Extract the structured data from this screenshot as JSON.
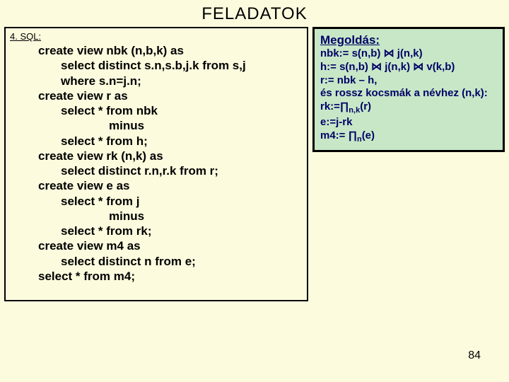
{
  "title": "FELADATOK",
  "sql_label": "4. SQL:",
  "sql": {
    "l1": "create view nbk (n,b,k) as",
    "l2": "select distinct s.n,s.b,j.k from s,j",
    "l3": "where s.n=j.n;",
    "l4": "create view r as",
    "l5": "select * from nbk",
    "l6": "minus",
    "l7": "select * from h;",
    "l8": "create view rk (n,k) as",
    "l9": "select distinct r.n,r.k from r;",
    "l10": "create view e as",
    "l11": "select * from j",
    "l12": "minus",
    "l13": "select * from rk;",
    "l14": "create view m4 as",
    "l15": "select distinct n from e;",
    "l16": "select * from m4;"
  },
  "solution": {
    "title": "Megoldás:",
    "nbk_lhs": "nbk:= s(n,b) ",
    "nbk_join": "⋈",
    "nbk_rhs": " j(n,k)",
    "h_1": "h:= s(n,b) ",
    "h_j1": "⋈",
    "h_2": " j(n,k) ",
    "h_j2": "⋈",
    "h_3": " v(k,b)",
    "r": "r:= nbk – h,",
    "rossz": "és rossz kocsmák a névhez (n,k):",
    "rk_lhs": "rk:=∏",
    "rk_sub": "n,k",
    "rk_rhs": "(r)",
    "e": "e:=j-rk",
    "m4_lhs": "m4:= ∏",
    "m4_sub": "n",
    "m4_rhs": "(e)"
  },
  "page": "84"
}
